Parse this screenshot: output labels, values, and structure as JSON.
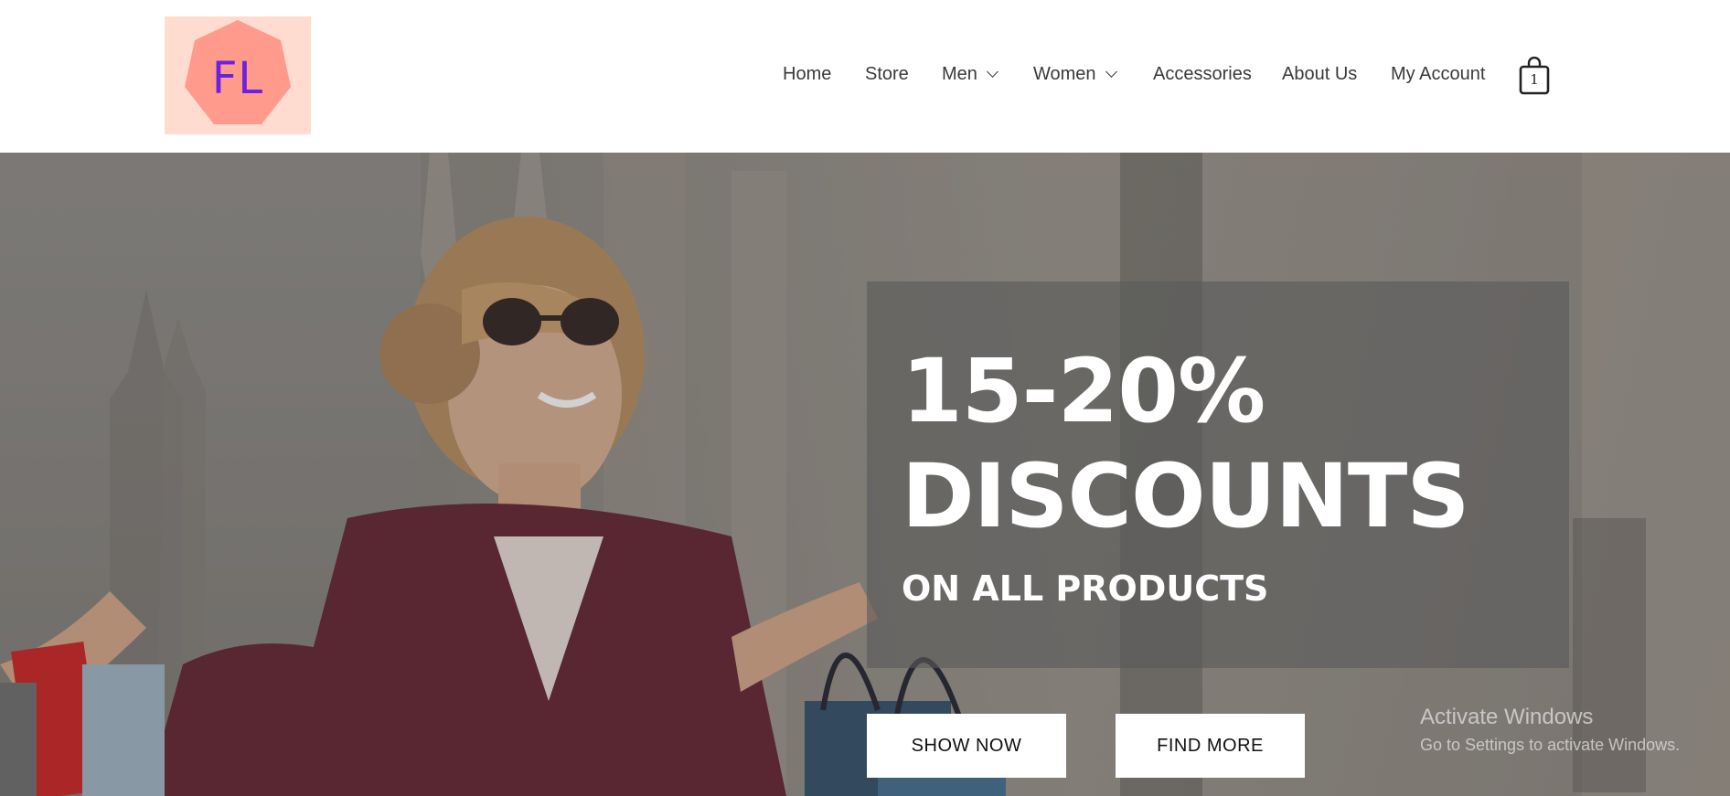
{
  "header": {
    "logo_text": "FL",
    "nav": [
      {
        "label": "Home"
      },
      {
        "label": "Store"
      },
      {
        "label": "Men"
      },
      {
        "label": "Women"
      },
      {
        "label": "Accessories"
      },
      {
        "label": "About Us"
      },
      {
        "label": "My Account"
      }
    ],
    "cart_count": "1"
  },
  "hero": {
    "headline_1": "15-20%",
    "headline_2": "DISCOUNTS",
    "subheadline": "ON ALL PRODUCTS",
    "show_button": "SHOW NOW",
    "find_button": "FIND MORE"
  },
  "os_watermark": {
    "title": "Activate Windows",
    "subtitle": "Go to Settings to activate Windows."
  },
  "colors": {
    "logo_bg": "#ffdccf",
    "logo_shape": "#ff9a8c",
    "logo_text": "#6b21e0",
    "nav_text": "#3a3a3a",
    "button_bg": "#ffffff"
  }
}
